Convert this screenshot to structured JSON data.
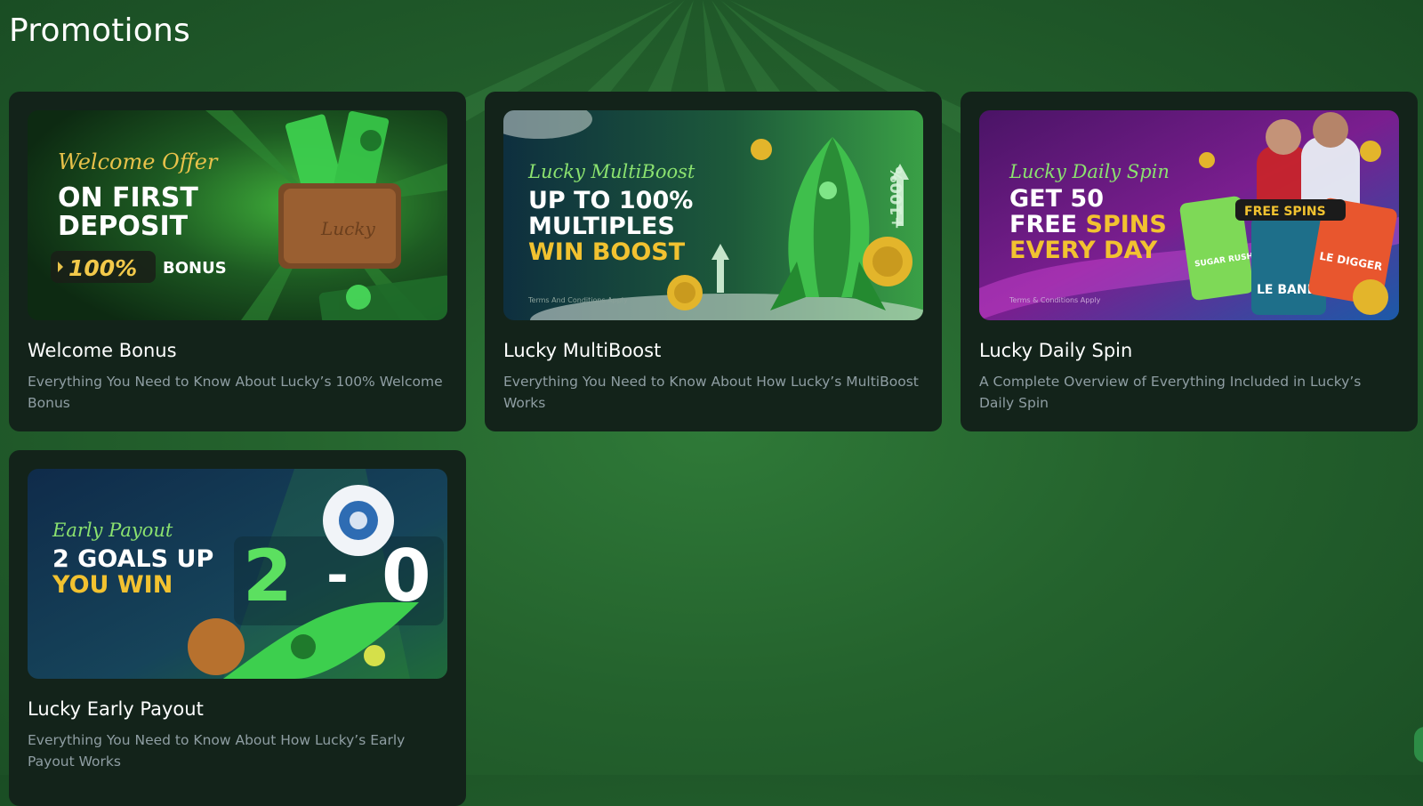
{
  "page": {
    "title": "Promotions"
  },
  "promotions": [
    {
      "title": "Welcome Bonus",
      "description": "Everything You Need to Know About Lucky’s 100% Welcome Bonus",
      "banner": {
        "script": "Welcome Offer",
        "line1": "ON FIRST",
        "line2": "DEPOSIT",
        "pill": "100%",
        "pill_suffix": "BONUS",
        "wallet_brand": "Lucky"
      }
    },
    {
      "title": "Lucky MultiBoost",
      "description": "Everything You Need to Know About How Lucky’s MultiBoost Works",
      "banner": {
        "script": "Lucky MultiBoost",
        "line1": "UP TO 100%",
        "line2": "MULTIPLES",
        "line3": "WIN BOOST",
        "side_label": "+100%",
        "fineprint": "Terms And Conditions Apply"
      }
    },
    {
      "title": "Lucky Daily Spin",
      "description": "A Complete Overview of Everything Included in Lucky’s Daily Spin",
      "banner": {
        "script": "Lucky Daily Spin",
        "line1": "GET 50",
        "line2a": "FREE ",
        "line2b": "SPINS",
        "line3": "EVERY DAY",
        "badge": "FREE SPINS",
        "game1": "SUGAR RUSH SUPER SCAT",
        "game2": "LE BANDIT",
        "game3": "LE DIGGER",
        "fineprint": "Terms & Conditions Apply"
      }
    },
    {
      "title": "Lucky Early Payout",
      "description": "Everything You Need to Know About How Lucky’s Early Payout Works",
      "banner": {
        "script": "Early Payout",
        "line1": "2 GOALS UP",
        "line2": "YOU WIN",
        "score_left": "2",
        "score_sep": "-",
        "score_right": "0"
      }
    }
  ],
  "colors": {
    "page_bg": "#24622d",
    "card_bg": "#13231a",
    "desc_text": "#8f9ea3",
    "accent_green": "#7ce36b",
    "accent_yellow": "#f2c230"
  }
}
